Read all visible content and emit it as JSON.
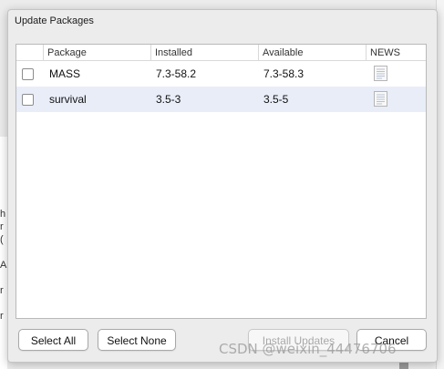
{
  "dialog": {
    "title": "Update Packages"
  },
  "table": {
    "columns": [
      "",
      "Package",
      "Installed",
      "Available",
      "NEWS"
    ],
    "rows": [
      {
        "checked": false,
        "package": "MASS",
        "installed": "7.3-58.2",
        "available": "7.3-58.3",
        "news_icon": "document-icon"
      },
      {
        "checked": false,
        "package": "survival",
        "installed": "3.5-3",
        "available": "3.5-5",
        "news_icon": "document-icon"
      }
    ]
  },
  "buttons": {
    "select_all": "Select All",
    "select_none": "Select None",
    "install_updates": "Install Updates",
    "cancel": "Cancel"
  },
  "background": {
    "partial_letters": [
      "h",
      "r",
      "(",
      "",
      "A",
      "",
      "r",
      "",
      "r"
    ]
  },
  "watermark": "CSDN @weixin_44476706",
  "colors": {
    "selected_row": "#e8edf8",
    "dialog_bg": "#ececec"
  }
}
